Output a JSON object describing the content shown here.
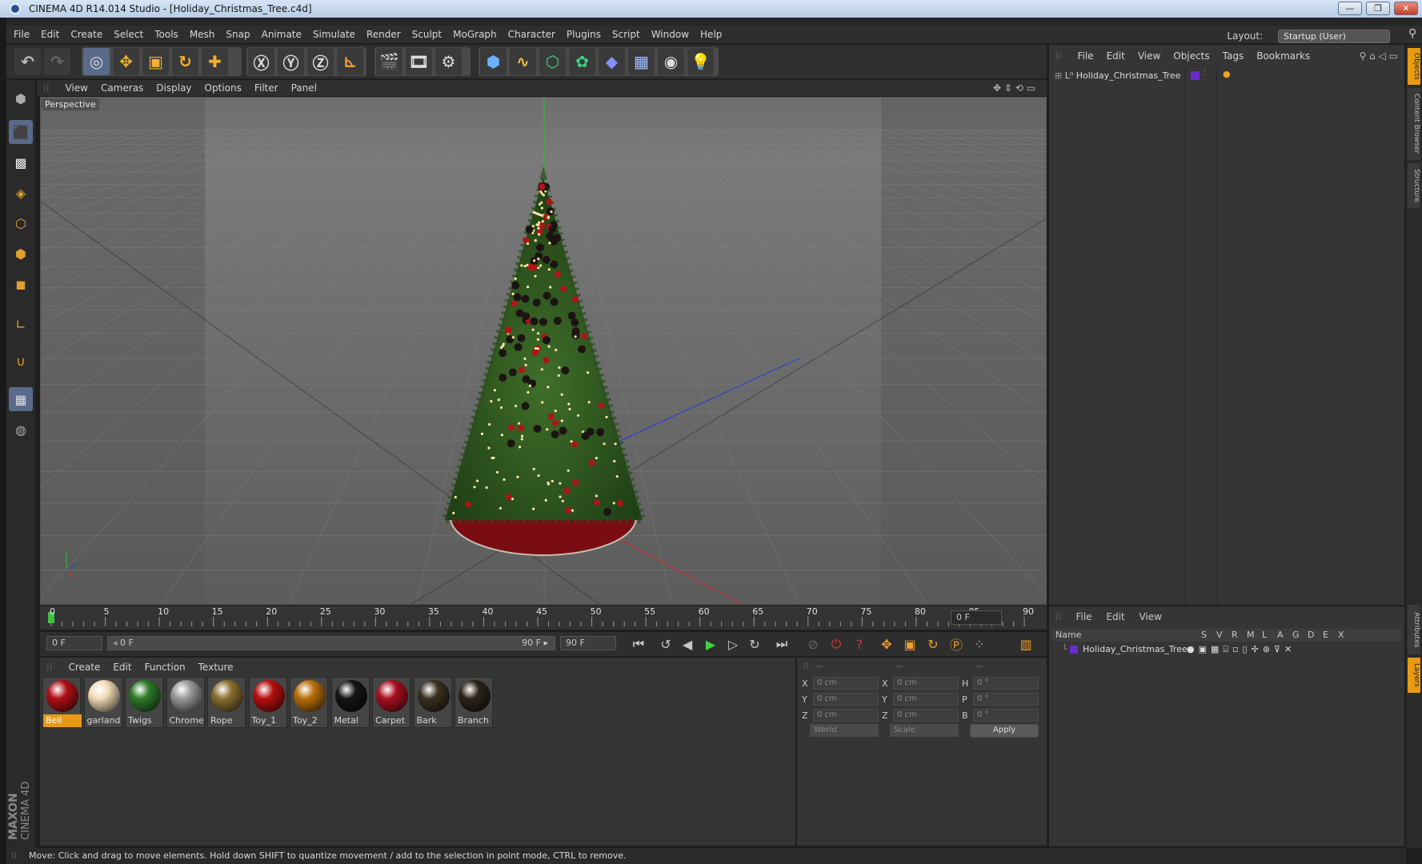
{
  "window": {
    "title": "CINEMA 4D R14.014 Studio - [Holiday_Christmas_Tree.c4d]",
    "buttons": [
      "—",
      "❐",
      "✕"
    ]
  },
  "menubar": {
    "items": [
      "File",
      "Edit",
      "Create",
      "Select",
      "Tools",
      "Mesh",
      "Snap",
      "Animate",
      "Simulate",
      "Render",
      "Sculpt",
      "MoGraph",
      "Character",
      "Plugins",
      "Script",
      "Window",
      "Help"
    ],
    "layout_label": "Layout:",
    "layout_value": "Startup (User)"
  },
  "viewport": {
    "menu": [
      "View",
      "Cameras",
      "Display",
      "Options",
      "Filter",
      "Panel"
    ],
    "label": "Perspective"
  },
  "timeline": {
    "ticks": [
      "0",
      "5",
      "10",
      "15",
      "20",
      "25",
      "30",
      "35",
      "40",
      "45",
      "50",
      "55",
      "60",
      "65",
      "70",
      "75",
      "80",
      "85",
      "90"
    ],
    "current_frame": "0 F",
    "start": "0 F",
    "range_start": "0 F",
    "range_end": "90 F",
    "end": "90 F"
  },
  "materials": {
    "menu": [
      "Create",
      "Edit",
      "Function",
      "Texture"
    ],
    "items": [
      {
        "name": "Bell",
        "color": "#b01018"
      },
      {
        "name": "garland",
        "color": "#f3dcb8"
      },
      {
        "name": "Twigs",
        "color": "#2e7a2a"
      },
      {
        "name": "Chrome",
        "color": "#9a9a9a"
      },
      {
        "name": "Rope",
        "color": "#8a7030"
      },
      {
        "name": "Toy_1",
        "color": "#b81010"
      },
      {
        "name": "Toy_2",
        "color": "#b8700c"
      },
      {
        "name": "Metal",
        "color": "#151515"
      },
      {
        "name": "Carpet",
        "color": "#a81020"
      },
      {
        "name": "Bark",
        "color": "#3a3020"
      },
      {
        "name": "Branch",
        "color": "#2c2418"
      }
    ],
    "selected": "Bell"
  },
  "coords": {
    "headers": [
      "--",
      "--",
      "--"
    ],
    "rows": [
      {
        "a": "X",
        "av": "0 cm",
        "b": "X",
        "bv": "0 cm",
        "c": "H",
        "cv": "0 °"
      },
      {
        "a": "Y",
        "av": "0 cm",
        "b": "Y",
        "bv": "0 cm",
        "c": "P",
        "cv": "0 °"
      },
      {
        "a": "Z",
        "av": "0 cm",
        "b": "Z",
        "bv": "0 cm",
        "c": "B",
        "cv": "0 °"
      }
    ],
    "mode1": "World",
    "mode2": "Scale",
    "apply": "Apply"
  },
  "objects": {
    "menu": [
      "File",
      "Edit",
      "View",
      "Objects",
      "Tags",
      "Bookmarks"
    ],
    "tree": [
      {
        "name": "Holiday_Christmas_Tree"
      }
    ]
  },
  "attributes": {
    "menu": [
      "File",
      "Edit",
      "View"
    ],
    "columns": [
      "Name",
      "S",
      "V",
      "R",
      "M",
      "L",
      "A",
      "G",
      "D",
      "E",
      "X"
    ],
    "rows": [
      {
        "name": "Holiday_Christmas_Tree"
      }
    ]
  },
  "right_tabs": [
    "Objects",
    "Content Browser",
    "Structure",
    "Attributes",
    "Layers"
  ],
  "status": "Move: Click and drag to move elements. Hold down SHIFT to quantize movement / add to the selection in point mode, CTRL to remove.",
  "brand": {
    "line1": "MAXON",
    "line2": "CINEMA 4D"
  },
  "colors": {
    "accent": "#e89a10",
    "selection": "#e89a10",
    "x_axis": "#c83030",
    "y_axis": "#30c030",
    "z_axis": "#3040c8"
  }
}
